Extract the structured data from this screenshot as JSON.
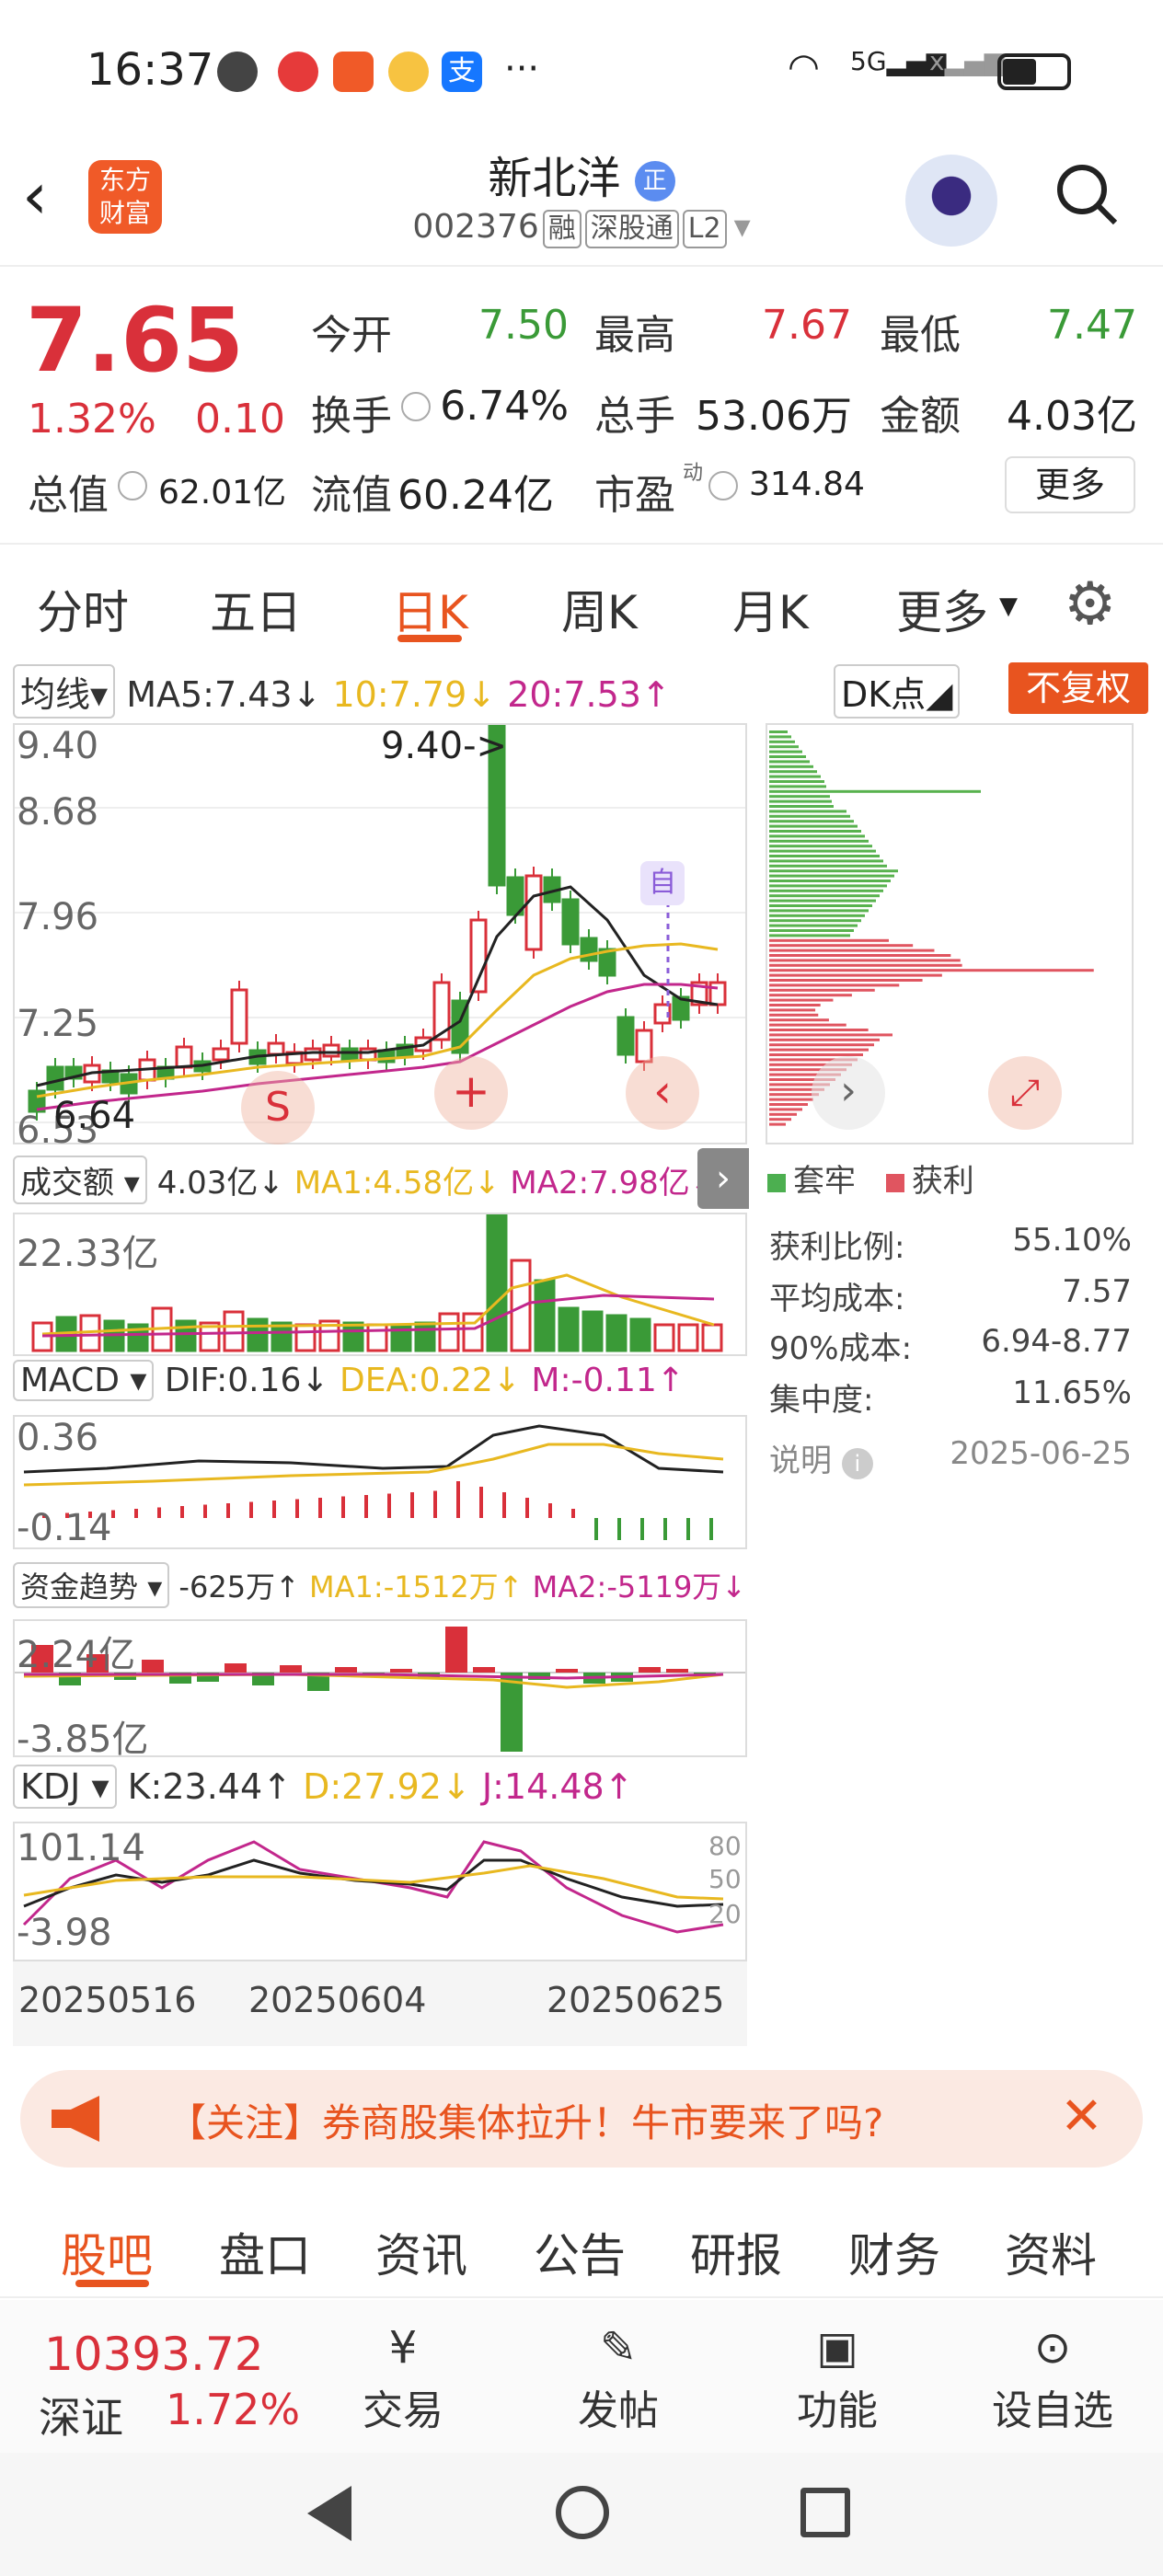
{
  "status": {
    "time": "16:37"
  },
  "header": {
    "title": "新北洋",
    "title_badge": "正",
    "code": "002376",
    "tags": [
      "融",
      "深股通",
      "L2"
    ]
  },
  "quote": {
    "price": "7.65",
    "change_pct": "1.32%",
    "change": "0.10",
    "open_label": "今开",
    "open": "7.50",
    "high_label": "最高",
    "high": "7.67",
    "low_label": "最低",
    "low": "7.47",
    "turnover_label": "换手",
    "turnover": "6.74%",
    "volume_label": "总手",
    "volume": "53.06万",
    "amount_label": "金额",
    "amount": "4.03亿",
    "mktcap_label": "总值",
    "mktcap": "62.01亿",
    "float_label": "流值",
    "float": "60.24亿",
    "pe_label": "市盈",
    "pe_sup": "动",
    "pe": "314.84",
    "more": "更多"
  },
  "tabs": [
    "分时",
    "五日",
    "日K",
    "周K",
    "月K",
    "更多"
  ],
  "kpanel": {
    "ma_select": "均线",
    "ma5": "MA5:7.43↓",
    "ma10": "10:7.79↓",
    "ma20": "20:7.53↑",
    "dk": "DK点",
    "fq": "不复权",
    "y_top": "9.40",
    "y2": "8.68",
    "y3": "7.96",
    "y4": "7.25",
    "y_bot": "6.53",
    "peak": "9.40->",
    "low": "6.64",
    "zi": "自"
  },
  "chips": {
    "legend_a": "套牢",
    "legend_b": "获利",
    "stats": [
      {
        "label": "获利比例:",
        "value": "55.10%"
      },
      {
        "label": "平均成本:",
        "value": "7.57"
      },
      {
        "label": "90%成本:",
        "value": "6.94-8.77"
      },
      {
        "label": "集中度:",
        "value": "11.65%"
      }
    ],
    "note_label": "说明",
    "note_date": "2025-06-25"
  },
  "volpanel": {
    "select": "成交额",
    "val": "4.03亿↓",
    "ma1": "MA1:4.58亿↓",
    "ma2": "MA2:7.98亿↓",
    "y_top": "22.33亿"
  },
  "macd": {
    "select": "MACD",
    "dif": "DIF:0.16↓",
    "dea": "DEA:0.22↓",
    "m": "M:-0.11↑",
    "y_top": "0.36",
    "y_bot": "-0.14"
  },
  "fund": {
    "select": "资金趋势",
    "val": "-625万↑",
    "ma1": "MA1:-1512万↑",
    "ma2": "MA2:-5119万↓",
    "y_top": "2.24亿",
    "y_bot": "-3.85亿"
  },
  "kdj": {
    "select": "KDJ",
    "k": "K:23.44↑",
    "d": "D:27.92↓",
    "j": "J:14.48↑",
    "y_top": "101.14",
    "y_bot": "-3.98",
    "r80": "80",
    "r50": "50",
    "r20": "20"
  },
  "dates": [
    "20250516",
    "20250604",
    "20250625"
  ],
  "notice": "【关注】券商股集体拉升！牛市要来了吗?",
  "bottom_tabs": [
    "股吧",
    "盘口",
    "资讯",
    "公告",
    "研报",
    "财务",
    "资料"
  ],
  "bottom_bar": {
    "index_value": "10393.72",
    "index_name": "深证",
    "index_pct": "1.72%",
    "items": [
      "交易",
      "发帖",
      "功能",
      "设自选"
    ]
  },
  "colors": {
    "up": "#d9303a",
    "down": "#3a9a37",
    "ma5": "#222222",
    "ma10": "#e8b820",
    "ma20": "#c2278c",
    "accent": "#e8541f"
  }
}
